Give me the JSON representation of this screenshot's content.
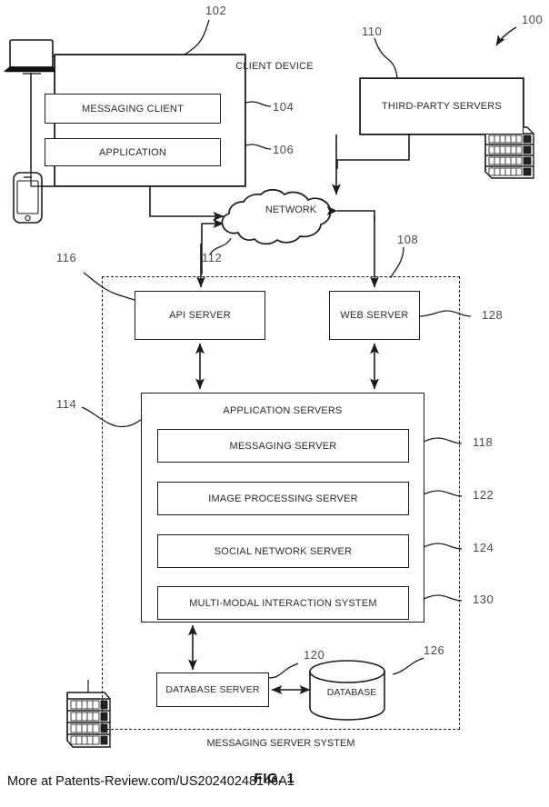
{
  "figure": {
    "caption": "FIG. 1",
    "source_note": "More at Patents-Review.com/US20240248146A1",
    "system_ref": "100"
  },
  "blocks": {
    "client_device": {
      "label": "CLIENT DEVICE",
      "ref": "102"
    },
    "messaging_client": {
      "label": "MESSAGING CLIENT",
      "ref": "104"
    },
    "application": {
      "label": "APPLICATION",
      "ref": "106"
    },
    "third_party_servers": {
      "label": "THIRD-PARTY SERVERS",
      "ref": "110"
    },
    "network": {
      "label": "NETWORK",
      "ref": "112"
    },
    "api_server": {
      "label": "API SERVER",
      "ref": "116"
    },
    "web_server": {
      "label": "WEB SERVER",
      "ref": "128"
    },
    "application_servers": {
      "label": "APPLICATION SERVERS",
      "ref": "114"
    },
    "messaging_server": {
      "label": "MESSAGING SERVER",
      "ref": "118"
    },
    "image_processing_server": {
      "label": "IMAGE PROCESSING SERVER",
      "ref": "122"
    },
    "social_network_server": {
      "label": "SOCIAL NETWORK SERVER",
      "ref": "124"
    },
    "multi_modal_interaction_system": {
      "label": "MULTI-MODAL INTERACTION SYSTEM",
      "ref": "130"
    },
    "database_server": {
      "label": "DATABASE SERVER",
      "ref": "120"
    },
    "database": {
      "label": "DATABASE",
      "ref": "126"
    },
    "messaging_server_system": {
      "label": "MESSAGING SERVER SYSTEM",
      "ref": "108"
    }
  },
  "icons": {
    "laptop": "laptop-icon",
    "smartphone": "smartphone-icon",
    "server_rack_top": "server-rack-icon",
    "server_rack_bottom": "server-rack-icon",
    "cloud": "cloud-icon",
    "cylinder": "database-cylinder-icon"
  },
  "colors": {
    "stroke": "#1a1a1a",
    "text": "#2b2b2b",
    "ref_text": "#4a4a4a",
    "background": "#ffffff"
  }
}
